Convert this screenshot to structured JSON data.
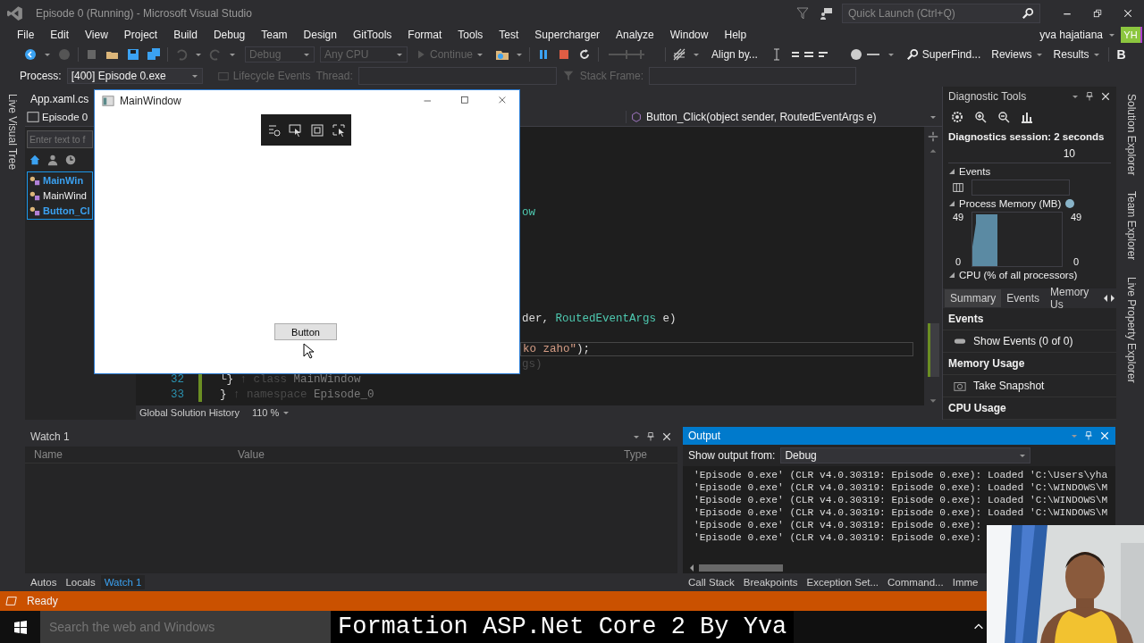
{
  "title_bar": {
    "title": "Episode 0 (Running) - Microsoft Visual Studio",
    "quick_launch": {
      "placeholder": "Quick Launch (Ctrl+Q)"
    }
  },
  "menu": [
    "File",
    "Edit",
    "View",
    "Project",
    "Build",
    "Debug",
    "Team",
    "Design",
    "GitTools",
    "Format",
    "Tools",
    "Test",
    "Supercharger",
    "Analyze",
    "Window",
    "Help"
  ],
  "account": {
    "name": "yva hajatiana",
    "initials": "YH"
  },
  "toolbar": {
    "items": [
      {
        "label": "Debug",
        "kind": "dropdown",
        "disabled": true
      },
      {
        "label": "Any CPU",
        "kind": "dropdown",
        "disabled": true
      },
      {
        "label": "Continue",
        "kind": "run",
        "disabled": true
      },
      {
        "label": "Align by...",
        "kind": "button",
        "disabled": false
      },
      {
        "label": "SuperFind...",
        "kind": "search",
        "disabled": false
      },
      {
        "label": "Reviews",
        "kind": "menu",
        "disabled": false
      },
      {
        "label": "Results",
        "kind": "menu",
        "disabled": false
      },
      {
        "label": "B",
        "kind": "button",
        "disabled": false
      }
    ]
  },
  "debug_location": {
    "process_label": "Process:",
    "process": "[400] Episode 0.exe",
    "lifecycle": "Lifecycle Events",
    "thread_label": "Thread:",
    "stack_frame_label": "Stack Frame:"
  },
  "left_strip": [
    "Live Visual Tree"
  ],
  "editor": {
    "doc_tab": "App.xaml.cs",
    "project": "Episode 0",
    "member": "Button_Click(object sender, RoutedEventArgs e)",
    "lines": [
      {
        "current": false,
        "segments": [
          {
            "kind": "type",
            "text": "ow"
          }
        ]
      },
      {
        "current": false,
        "segments": [
          {
            "kind": "plain",
            "text": "der, "
          },
          {
            "kind": "type",
            "text": "RoutedEventArgs"
          },
          {
            "kind": "plain",
            "text": " e)"
          }
        ]
      },
      {
        "current": true,
        "segments": [
          {
            "kind": "string",
            "text": "ko zaho\""
          },
          {
            "kind": "plain",
            "text": ");"
          }
        ]
      },
      {
        "current": false,
        "segments": [
          {
            "kind": "faded",
            "text": "gs)"
          }
        ]
      },
      {
        "number": "32",
        "current": false,
        "segments": [
          {
            "kind": "brace",
            "text": "└}"
          },
          {
            "kind": "faded",
            "text": " ↑ class "
          },
          {
            "kind": "hint",
            "text": "MainWindow"
          }
        ]
      },
      {
        "number": "33",
        "current": false,
        "segments": [
          {
            "kind": "brace",
            "text": "}"
          },
          {
            "kind": "faded",
            "text": " ↑ namespace "
          },
          {
            "kind": "hint",
            "text": "Episode_0"
          }
        ]
      }
    ],
    "history": "Global Solution History",
    "zoom": "110 %"
  },
  "live_tree": {
    "search": {
      "placeholder": "Enter text to f"
    },
    "items": [
      {
        "label": "MainWin",
        "highlighted": true
      },
      {
        "label": "MainWind",
        "highlighted": false
      },
      {
        "label": "Button_Cl",
        "highlighted": true
      }
    ]
  },
  "main_window": {
    "title": "MainWindow",
    "button": "Button"
  },
  "diagnostics": {
    "title": "Diagnostic Tools",
    "session": "Diagnostics session: 2 seconds",
    "timeline_mark": "10",
    "events_heading": "Events",
    "memory_heading": "Process Memory (MB)",
    "memory_axis": [
      "49",
      "0",
      "49",
      "0"
    ],
    "cpu_heading": "CPU (% of all processors)",
    "tabs": [
      {
        "label": "Summary",
        "selected": true
      },
      {
        "label": "Events",
        "selected": false
      },
      {
        "label": "Memory Us",
        "selected": false
      }
    ],
    "list": [
      {
        "kind": "heading",
        "label": "Events"
      },
      {
        "kind": "events",
        "label": "Show Events (0 of 0)"
      },
      {
        "kind": "heading",
        "label": "Memory Usage"
      },
      {
        "kind": "snapshot",
        "label": "Take Snapshot"
      },
      {
        "kind": "heading",
        "label": "CPU Usage"
      }
    ]
  },
  "right_strip": [
    "Solution Explorer",
    "Team Explorer",
    "Live Property Explorer"
  ],
  "watch": {
    "title": "Watch 1",
    "columns": [
      "Name",
      "Value",
      "Type"
    ],
    "tabs": [
      {
        "label": "Autos",
        "selected": false
      },
      {
        "label": "Locals",
        "selected": false
      },
      {
        "label": "Watch 1",
        "selected": true
      }
    ]
  },
  "output": {
    "title": "Output",
    "source_label": "Show output from:",
    "source": "Debug",
    "lines": [
      "'Episode 0.exe' (CLR v4.0.30319: Episode 0.exe): Loaded 'C:\\Users\\yha",
      "'Episode 0.exe' (CLR v4.0.30319: Episode 0.exe): Loaded 'C:\\WINDOWS\\M",
      "'Episode 0.exe' (CLR v4.0.30319: Episode 0.exe): Loaded 'C:\\WINDOWS\\M",
      "'Episode 0.exe' (CLR v4.0.30319: Episode 0.exe): Loaded 'C:\\WINDOWS\\M",
      "'Episode 0.exe' (CLR v4.0.30319: Episode 0.exe):",
      "'Episode 0.exe' (CLR v4.0.30319: Episode 0.exe):"
    ],
    "tabs": [
      {
        "label": "Call Stack",
        "selected": false
      },
      {
        "label": "Breakpoints",
        "selected": false
      },
      {
        "label": "Exception Set...",
        "selected": false
      },
      {
        "label": "Command...",
        "selected": false
      },
      {
        "label": "Imme",
        "selected": false
      }
    ]
  },
  "status": "Ready",
  "taskbar": {
    "search": {
      "placeholder": "Search the web and Windows"
    }
  },
  "caption": "Formation ASP.Net Core 2 By Yva"
}
